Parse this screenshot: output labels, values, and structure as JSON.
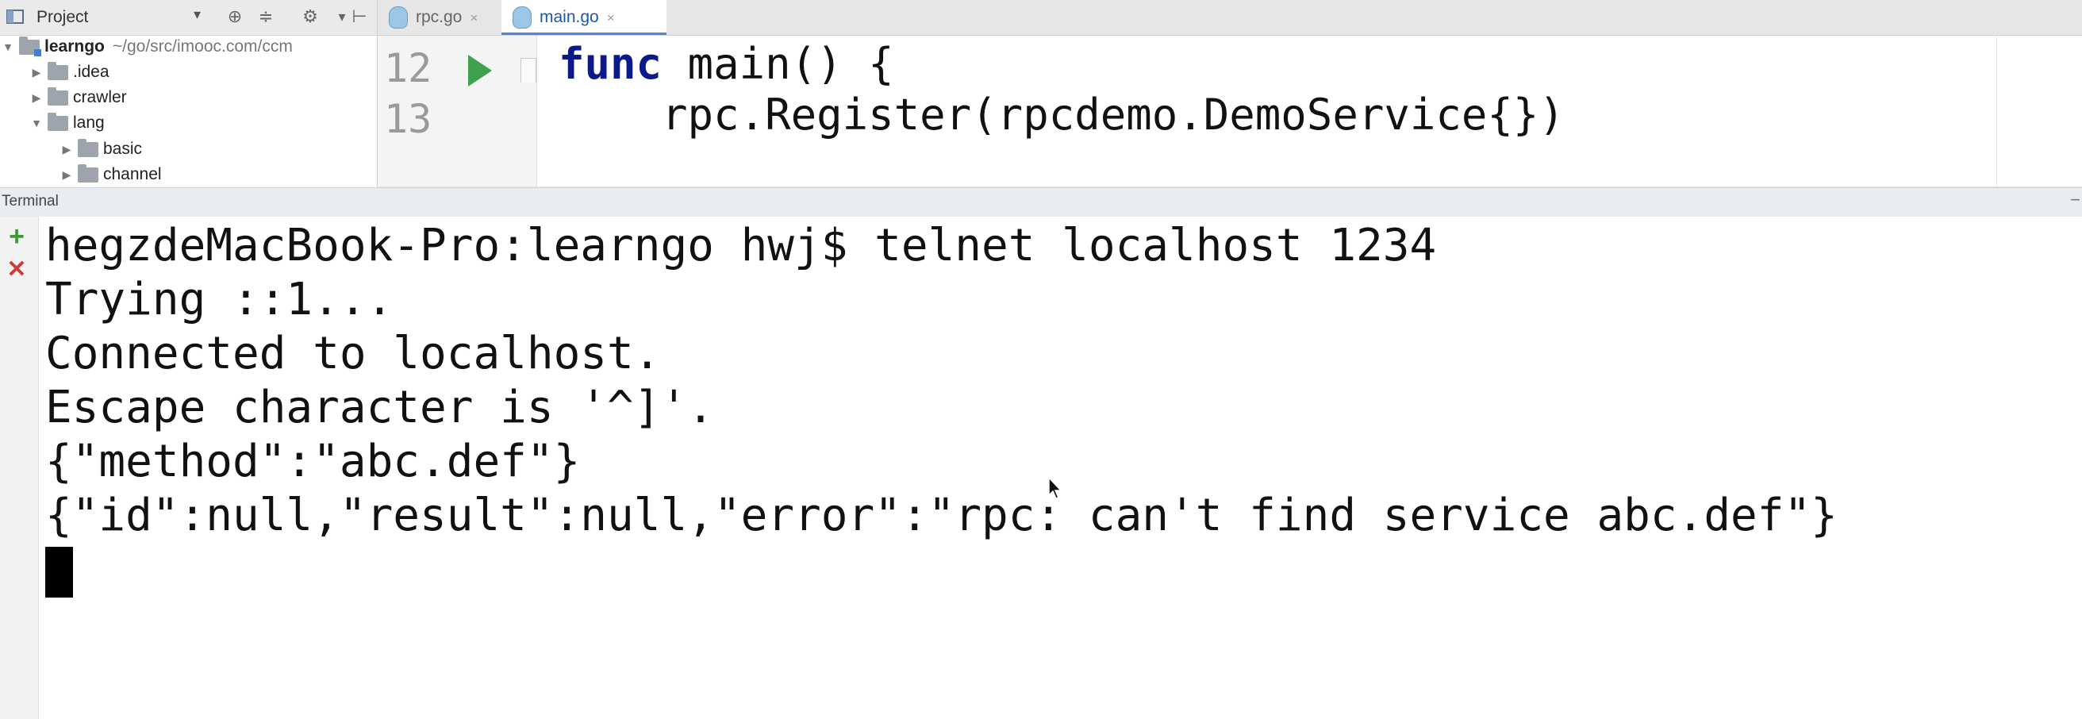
{
  "project_panel": {
    "title": "Project",
    "dropdown_icon": "chevron-down-icon",
    "toolbar_icons": [
      "scroll-from-source-icon",
      "collapse-all-icon",
      "gear-icon",
      "hide-icon"
    ],
    "tree": [
      {
        "label": "learngo",
        "path": "~/go/src/imooc.com/ccm",
        "expanded": true,
        "bold": true
      },
      {
        "label": ".idea",
        "expanded": false
      },
      {
        "label": "crawler",
        "expanded": false
      },
      {
        "label": "lang",
        "expanded": true
      },
      {
        "label": "basic",
        "expanded": false
      },
      {
        "label": "channel",
        "expanded": false
      }
    ]
  },
  "tabs": [
    {
      "label": "rpc.go",
      "active": false,
      "close": "×"
    },
    {
      "label": "main.go",
      "active": true,
      "close": "×"
    }
  ],
  "editor": {
    "lines": [
      {
        "number": "12",
        "keyword": "func",
        "rest": " main() {"
      },
      {
        "number": "13",
        "keyword": "",
        "rest": "    rpc.Register(rpcdemo.DemoService{})"
      }
    ]
  },
  "terminal": {
    "title": "Terminal",
    "collapse": "−",
    "new_session": "+",
    "close_session": "✕",
    "lines": [
      "hegzdeMacBook-Pro:learngo hwj$ telnet localhost 1234",
      "Trying ::1...",
      "Connected to localhost.",
      "Escape character is '^]'.",
      "{\"method\":\"abc.def\"}",
      "{\"id\":null,\"result\":null,\"error\":\"rpc: can't find service abc.def\"}"
    ]
  },
  "colors": {
    "keyword": "#0b1a8a",
    "run_icon": "#3ea14c",
    "active_tab_text": "#1c58a8",
    "terminal_header_bg": "#e9edf2"
  }
}
